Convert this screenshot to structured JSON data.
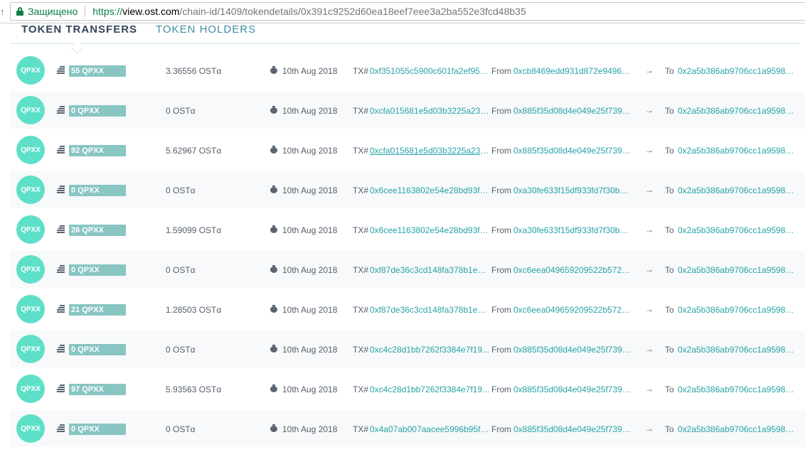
{
  "browser": {
    "secure_label": "Защищено",
    "url_scheme": "https://",
    "url_host": "view.ost.com",
    "url_path": "/chain-id/1409/tokendetails/0x391c9252d60ea18eef7eee3a2ba552e3fcd48b35"
  },
  "tabs": [
    {
      "label": "TOKEN TRANSFERS",
      "active": true
    },
    {
      "label": "TOKEN HOLDERS",
      "active": false
    }
  ],
  "labels": {
    "tx": "TX#",
    "from": "From",
    "to": "To",
    "arrow": "→"
  },
  "colors": {
    "avatar": "#5ee0c8",
    "badge": "#88c5c3",
    "link": "#27a3a7",
    "active_tab": "#34445b",
    "inactive_tab": "#3e8ea3"
  },
  "transfers": [
    {
      "token": "QPXX",
      "block": "55 QPXX",
      "amount": "3.36556 OSTα",
      "date": "10th Aug 2018",
      "tx": "0xf351055c5900c601fa2ef955...",
      "from": "0xcb8469edd931d872e94969...",
      "to": "0x2a5b386ab9706cc1a9598ea..."
    },
    {
      "token": "QPXX",
      "block": "0 QPXX",
      "amount": "0 OSTα",
      "date": "10th Aug 2018",
      "tx": "0xcfa015681e5d03b3225a23ef...",
      "from": "0x885f35d08d4e049e25f7390...",
      "to": "0x2a5b386ab9706cc1a9598ea..."
    },
    {
      "token": "QPXX",
      "block": "92 QPXX",
      "amount": "5.62967 OSTα",
      "date": "10th Aug 2018",
      "tx": "0xcfa015681e5d03b3225a23ef...",
      "from": "0x885f35d08d4e049e25f7390...",
      "to": "0x2a5b386ab9706cc1a9598ea..."
    },
    {
      "token": "QPXX",
      "block": "0 QPXX",
      "amount": "0 OSTα",
      "date": "10th Aug 2018",
      "tx": "0x6cee1163802e54e28bd93f4...",
      "from": "0xa30fe633f15df933fd7f30bac...",
      "to": "0x2a5b386ab9706cc1a9598ea..."
    },
    {
      "token": "QPXX",
      "block": "26 QPXX",
      "amount": "1.59099 OSTα",
      "date": "10th Aug 2018",
      "tx": "0x6cee1163802e54e28bd93f4...",
      "from": "0xa30fe633f15df933fd7f30bac...",
      "to": "0x2a5b386ab9706cc1a9598ea..."
    },
    {
      "token": "QPXX",
      "block": "0 QPXX",
      "amount": "0 OSTα",
      "date": "10th Aug 2018",
      "tx": "0xf87de36c3cd148fa378b1eaa...",
      "from": "0xc6eea049659209522b572ad...",
      "to": "0x2a5b386ab9706cc1a9598ea..."
    },
    {
      "token": "QPXX",
      "block": "21 QPXX",
      "amount": "1.28503 OSTα",
      "date": "10th Aug 2018",
      "tx": "0xf87de36c3cd148fa378b1eaa...",
      "from": "0xc6eea049659209522b572ad...",
      "to": "0x2a5b386ab9706cc1a9598ea..."
    },
    {
      "token": "QPXX",
      "block": "0 QPXX",
      "amount": "0 OSTα",
      "date": "10th Aug 2018",
      "tx": "0xc4c28d1bb7262f3384e7f19...",
      "from": "0x885f35d08d4e049e25f7390...",
      "to": "0x2a5b386ab9706cc1a9598ea..."
    },
    {
      "token": "QPXX",
      "block": "97 QPXX",
      "amount": "5.93563 OSTα",
      "date": "10th Aug 2018",
      "tx": "0xc4c28d1bb7262f3384e7f19...",
      "from": "0x885f35d08d4e049e25f7390...",
      "to": "0x2a5b386ab9706cc1a9598ea..."
    },
    {
      "token": "QPXX",
      "block": "0 QPXX",
      "amount": "0 OSTα",
      "date": "10th Aug 2018",
      "tx": "0x4a07ab007aacee5996b95ff6...",
      "from": "0x885f35d08d4e049e25f7390...",
      "to": "0x2a5b386ab9706cc1a9598ea..."
    }
  ]
}
